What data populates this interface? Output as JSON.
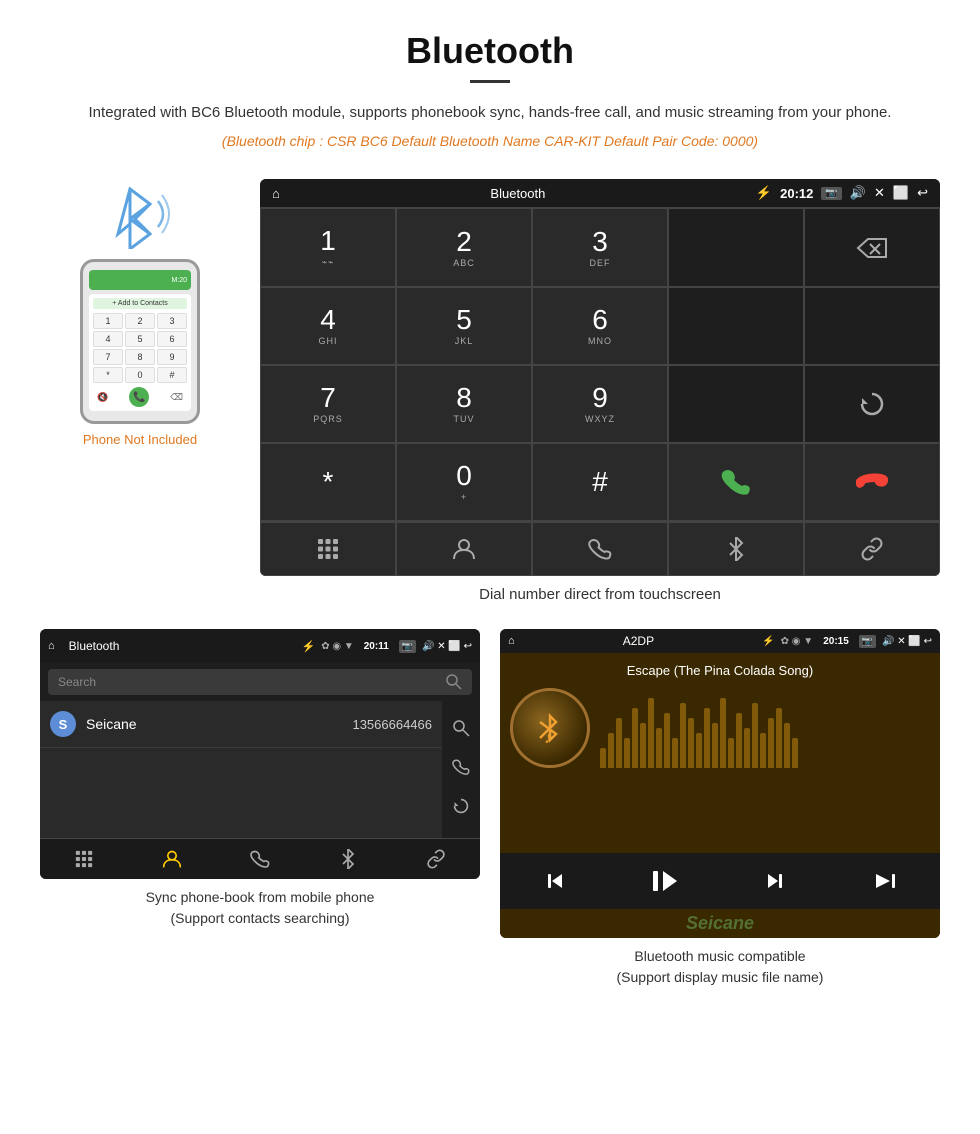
{
  "header": {
    "title": "Bluetooth",
    "description": "Integrated with BC6 Bluetooth module, supports phonebook sync, hands-free call, and music streaming from your phone.",
    "specs": "(Bluetooth chip : CSR BC6   Default Bluetooth Name CAR-KIT    Default Pair Code: 0000)"
  },
  "phone_aside": {
    "not_included": "Phone Not Included"
  },
  "dial_screen": {
    "status_bar": {
      "home_icon": "⌂",
      "title": "Bluetooth",
      "usb_icon": "⚡",
      "bt_icon": "✿",
      "location_icon": "◉",
      "signal_icon": "▼",
      "time": "20:12",
      "camera_icon": "📷",
      "volume_icon": "🔊",
      "close_icon": "✕",
      "screen_icon": "⬜",
      "back_icon": "↩"
    },
    "keys": [
      {
        "num": "1",
        "sub": "⌁⌁"
      },
      {
        "num": "2",
        "sub": "ABC"
      },
      {
        "num": "3",
        "sub": "DEF"
      },
      {
        "num": "",
        "sub": ""
      },
      {
        "num": "⌫",
        "sub": ""
      },
      {
        "num": "4",
        "sub": "GHI"
      },
      {
        "num": "5",
        "sub": "JKL"
      },
      {
        "num": "6",
        "sub": "MNO"
      },
      {
        "num": "",
        "sub": ""
      },
      {
        "num": "",
        "sub": ""
      },
      {
        "num": "7",
        "sub": "PQRS"
      },
      {
        "num": "8",
        "sub": "TUV"
      },
      {
        "num": "9",
        "sub": "WXYZ"
      },
      {
        "num": "",
        "sub": ""
      },
      {
        "num": "↻",
        "sub": ""
      },
      {
        "num": "*",
        "sub": ""
      },
      {
        "num": "0",
        "sub": "+"
      },
      {
        "num": "#",
        "sub": ""
      },
      {
        "num": "📞",
        "sub": "green"
      },
      {
        "num": "📞",
        "sub": "red"
      }
    ],
    "actions": [
      "⊞",
      "👤",
      "📞",
      "✿",
      "🔗"
    ],
    "caption": "Dial number direct from touchscreen"
  },
  "phonebook_screen": {
    "status_bar": {
      "home_icon": "⌂",
      "title": "Bluetooth",
      "usb_icon": "⚡",
      "bt_icon": "✿",
      "signal": "▼",
      "time": "20:11",
      "icons_right": "📷🔊✕⬜↩"
    },
    "search_placeholder": "Search",
    "contacts": [
      {
        "letter": "S",
        "name": "Seicane",
        "number": "13566664466"
      }
    ],
    "sidebar_icons": [
      "🔍",
      "📞",
      "↻"
    ],
    "bottom_icons": [
      "⊞",
      "👤",
      "📞",
      "✿",
      "🔗"
    ],
    "caption_line1": "Sync phone-book from mobile phone",
    "caption_line2": "(Support contacts searching)"
  },
  "music_screen": {
    "status_bar": {
      "home_icon": "⌂",
      "title": "A2DP",
      "usb_icon": "⚡",
      "bt_icon": "✿",
      "signal": "▼",
      "time": "20:15",
      "icons_right": "📷🔊✕⬜↩"
    },
    "song_title": "Escape (The Pina Colada Song)",
    "bt_icon": "✿",
    "eq_bars": [
      20,
      35,
      50,
      30,
      60,
      45,
      70,
      40,
      55,
      30,
      65,
      50,
      35,
      60,
      45,
      70,
      30,
      55,
      40,
      65,
      35,
      50,
      60,
      45,
      30
    ],
    "controls": [
      "⏮",
      "⏯",
      "⏭"
    ],
    "caption_line1": "Bluetooth music compatible",
    "caption_line2": "(Support display music file name)"
  },
  "seicane": "Seicane"
}
